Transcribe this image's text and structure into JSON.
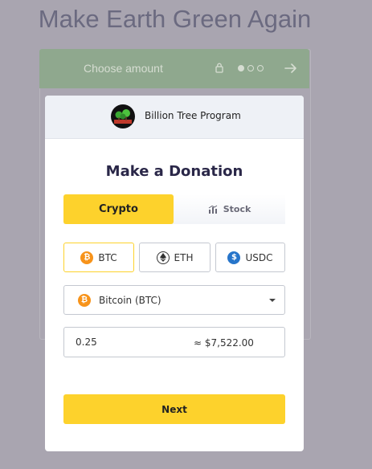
{
  "page": {
    "title": "Make Earth Green Again"
  },
  "background_step": {
    "label": "Choose amount",
    "lock_icon": "lock-icon",
    "arrow_icon": "arrow-right-icon",
    "step_count": 3,
    "active_step": 1
  },
  "modal": {
    "org_name": "Billion Tree Program",
    "org_logo_icon": "tree-logo",
    "title": "Make a Donation",
    "tabs": [
      {
        "label": "Crypto",
        "active": true
      },
      {
        "label": "Stock",
        "active": false,
        "icon": "bar-chart-icon"
      }
    ],
    "currencies": [
      {
        "label": "BTC",
        "icon": "bitcoin-icon",
        "selected": true
      },
      {
        "label": "ETH",
        "icon": "ethereum-icon",
        "selected": false
      },
      {
        "label": "USDC",
        "icon": "usdc-icon",
        "selected": false
      }
    ],
    "coin_select": {
      "value": "Bitcoin (BTC)",
      "icon": "bitcoin-icon"
    },
    "amount": {
      "value": "0.25",
      "usd_equivalent": "≈ $7,522.00"
    },
    "next_label": "Next"
  },
  "colors": {
    "accent": "#fdd22c",
    "overlay": "#a9a5b0",
    "step_header": "#8fa88e",
    "bitcoin": "#f7931a",
    "usdc": "#2775ca"
  }
}
